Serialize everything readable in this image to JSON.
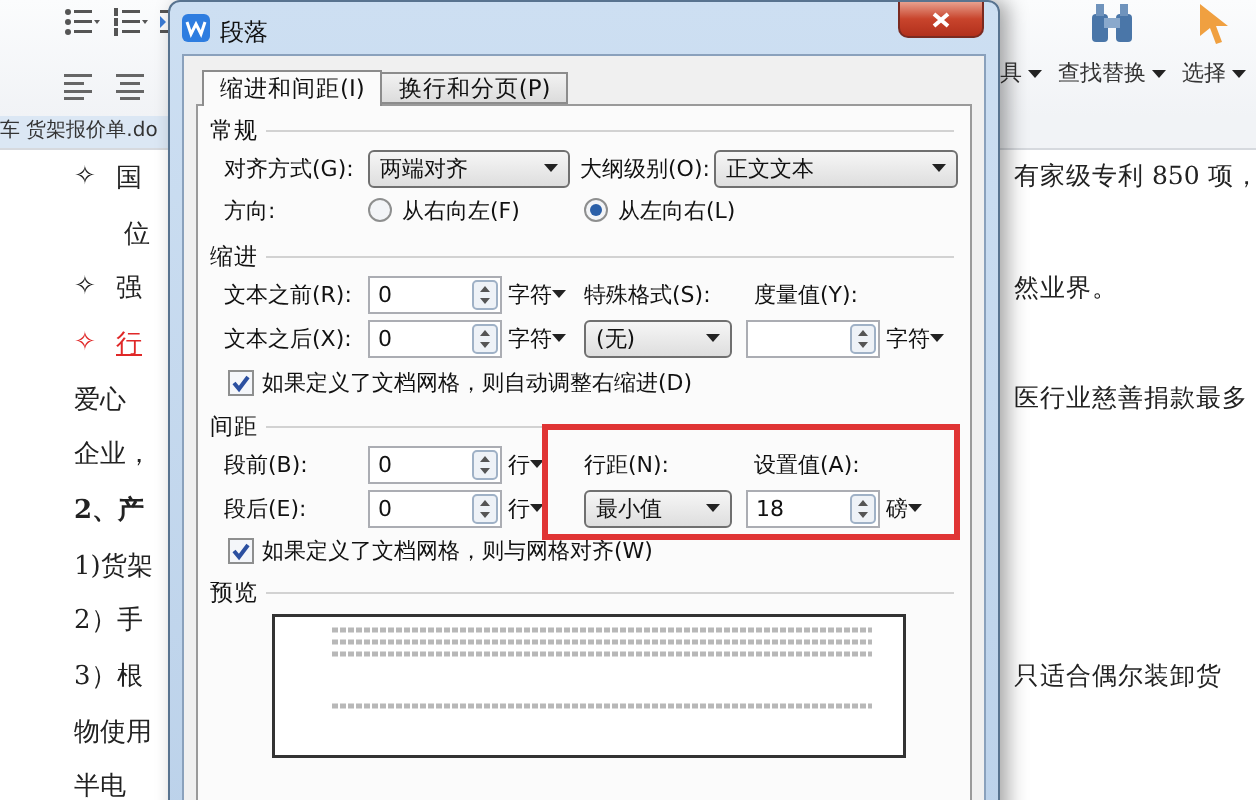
{
  "ribbon": {
    "items": [
      {
        "kind": "label",
        "label": "具"
      },
      {
        "kind": "find",
        "label": "查找替换"
      },
      {
        "kind": "select",
        "label": "选择"
      }
    ]
  },
  "document_tab": {
    "label": "车 货架报价单.do"
  },
  "document": {
    "lines": [
      {
        "kind": "bullet",
        "bullet": "✧",
        "left": "国",
        "right": "有家级专利 850 项，",
        "color": "#222222"
      },
      {
        "kind": "indent",
        "left": "位"
      },
      {
        "kind": "bullet",
        "bullet": "✧",
        "left": "强",
        "right": "然业界。",
        "color": "#222222"
      },
      {
        "kind": "bullet",
        "bullet": "✧",
        "left": "行",
        "color": "#e02828"
      },
      {
        "kind": "text",
        "left": "爱心",
        "right": "医行业慈善捐款最多"
      },
      {
        "kind": "text",
        "left": "企业，"
      },
      {
        "kind": "heading",
        "left": "2、产"
      },
      {
        "kind": "text",
        "left": "1)货架"
      },
      {
        "kind": "text",
        "left": "2）手"
      },
      {
        "kind": "text",
        "left": "3）根",
        "right": "只适合偶尔装卸货"
      },
      {
        "kind": "text",
        "left": "物使用"
      },
      {
        "kind": "text",
        "left": "半电"
      }
    ]
  },
  "dialog": {
    "title": "段落",
    "tabs": [
      {
        "label": "缩进和间距(I)",
        "selected": true
      },
      {
        "label": "换行和分页(P)",
        "selected": false
      }
    ],
    "general": {
      "heading": "常规",
      "alignment_label": "对齐方式(G):",
      "alignment": "两端对齐",
      "outline_label": "大纲级别(O):",
      "outline": "正文文本",
      "direction_label": "方向:",
      "directions": [
        {
          "label": "从右向左(F)",
          "selected": false
        },
        {
          "label": "从左向右(L)",
          "selected": true
        }
      ]
    },
    "indent": {
      "heading": "缩进",
      "before_label": "文本之前(R):",
      "before": "0",
      "before_unit": "字符",
      "after_label": "文本之后(X):",
      "after": "0",
      "after_unit": "字符",
      "special_label": "特殊格式(S):",
      "special": "(无)",
      "measure_label": "度量值(Y):",
      "measure_unit": "字符",
      "checkbox": {
        "label": "如果定义了文档网格，则自动调整右缩进(D)",
        "checked": true
      }
    },
    "spacing": {
      "heading": "间距",
      "before_label": "段前(B):",
      "before": "0",
      "before_unit": "行",
      "after_label": "段后(E):",
      "after": "0",
      "after_unit": "行",
      "line_label": "行距(N):",
      "line": "最小值",
      "value_label": "设置值(A):",
      "value": "18",
      "value_unit": "磅",
      "checkbox": {
        "label": "如果定义了文档网格，则与网格对齐(W)",
        "checked": true
      }
    },
    "preview": {
      "heading": "预览"
    }
  }
}
